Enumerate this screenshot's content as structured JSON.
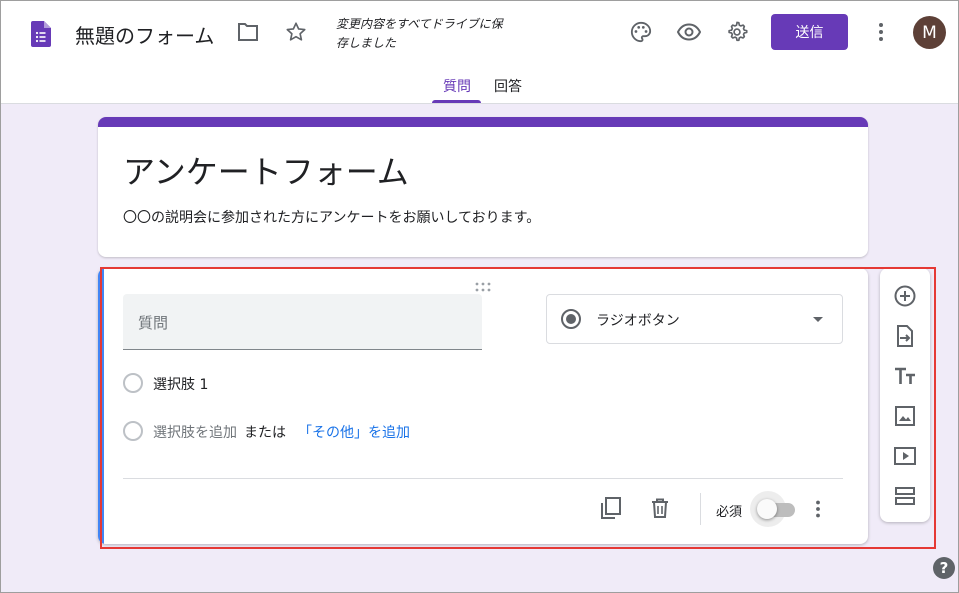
{
  "header": {
    "doc_title": "無題のフォーム",
    "save_status": "変更内容をすべてドライブに保存しました",
    "send_label": "送信",
    "avatar_letter": "M",
    "icons": [
      "form-doc-icon",
      "folder-icon",
      "star-icon",
      "palette-icon",
      "preview-eye-icon",
      "settings-gear-icon",
      "more-vert-icon"
    ],
    "tabs": [
      {
        "label": "質問",
        "active": true
      },
      {
        "label": "回答",
        "active": false
      }
    ]
  },
  "form": {
    "title": "アンケートフォーム",
    "description": "〇〇の説明会に参加された方にアンケートをお願いしております。"
  },
  "question": {
    "placeholder": "質問",
    "type_label": "ラジオボタン",
    "options": [
      "選択肢 1"
    ],
    "add_option": "選択肢を追加",
    "or_text": "または",
    "add_other": "「その他」を追加",
    "required_label": "必須",
    "required": false
  },
  "side_toolbar": {
    "icons": [
      "add-question-icon",
      "import-questions-icon",
      "add-title-icon",
      "add-image-icon",
      "add-video-icon",
      "add-section-icon"
    ]
  },
  "help_label": "?",
  "colors": {
    "accent": "#673ab7",
    "background": "#f0ebf8",
    "link": "#1a73e8",
    "highlight": "#e53935"
  }
}
